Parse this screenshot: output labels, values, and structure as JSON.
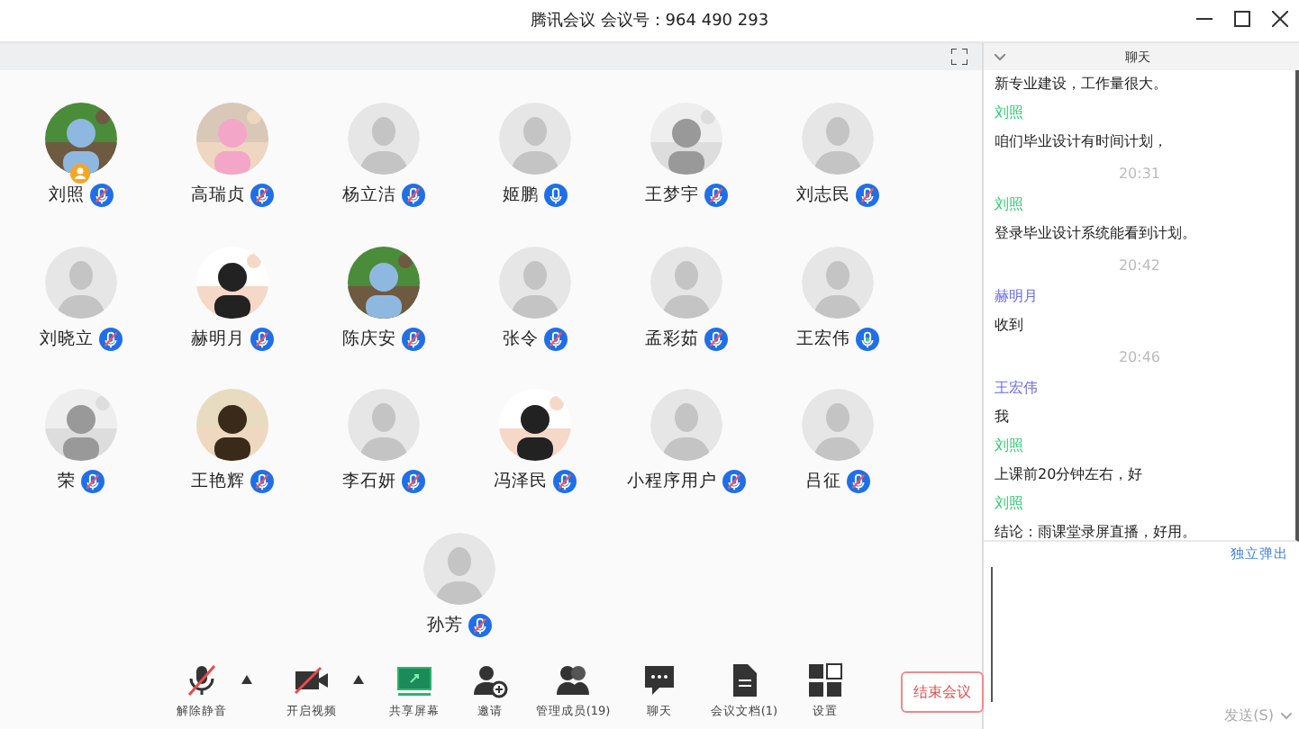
{
  "window": {
    "title": "腾讯会议 会议号：964 490 293"
  },
  "participants": [
    {
      "name": "刘照",
      "photo": true,
      "muted": true,
      "speaking": false,
      "host": true
    },
    {
      "name": "高瑞贞",
      "photo": true,
      "muted": true,
      "speaking": false,
      "host": false
    },
    {
      "name": "杨立洁",
      "photo": false,
      "muted": true,
      "speaking": false,
      "host": false
    },
    {
      "name": "姬鹏",
      "photo": false,
      "muted": false,
      "speaking": false,
      "host": false
    },
    {
      "name": "王梦宇",
      "photo": true,
      "muted": true,
      "speaking": false,
      "host": false
    },
    {
      "name": "刘志民",
      "photo": false,
      "muted": true,
      "speaking": false,
      "host": false
    },
    {
      "name": "刘晓立",
      "photo": false,
      "muted": true,
      "speaking": false,
      "host": false
    },
    {
      "name": "赫明月",
      "photo": true,
      "muted": true,
      "speaking": false,
      "host": false
    },
    {
      "name": "陈庆安",
      "photo": true,
      "muted": true,
      "speaking": false,
      "host": false
    },
    {
      "name": "张令",
      "photo": false,
      "muted": true,
      "speaking": false,
      "host": false
    },
    {
      "name": "孟彩茹",
      "photo": false,
      "muted": true,
      "speaking": false,
      "host": false
    },
    {
      "name": "王宏伟",
      "photo": false,
      "muted": false,
      "speaking": true,
      "host": false
    },
    {
      "name": "荣",
      "photo": true,
      "muted": true,
      "speaking": false,
      "host": false
    },
    {
      "name": "王艳辉",
      "photo": true,
      "muted": true,
      "speaking": false,
      "host": false
    },
    {
      "name": "李石妍",
      "photo": false,
      "muted": true,
      "speaking": false,
      "host": false
    },
    {
      "name": "冯泽民",
      "photo": true,
      "muted": true,
      "speaking": false,
      "host": false
    },
    {
      "name": "小程序用户",
      "photo": false,
      "muted": true,
      "speaking": false,
      "host": false
    },
    {
      "name": "吕征",
      "photo": false,
      "muted": true,
      "speaking": false,
      "host": false
    },
    {
      "name": "孙芳",
      "photo": false,
      "muted": true,
      "speaking": false,
      "host": false
    }
  ],
  "toolbar": [
    {
      "label": "解除静音",
      "kind": "mic",
      "menu": true
    },
    {
      "label": "开启视频",
      "kind": "video",
      "menu": true
    },
    {
      "label": "共享屏幕",
      "kind": "share",
      "menu": false
    },
    {
      "label": "邀请",
      "kind": "invite",
      "menu": false
    },
    {
      "label": "管理成员(19)",
      "kind": "members",
      "menu": false
    },
    {
      "label": "聊天",
      "kind": "chat",
      "menu": false
    },
    {
      "label": "会议文档(1)",
      "kind": "docs",
      "menu": false
    },
    {
      "label": "设置",
      "kind": "settings",
      "menu": false
    }
  ],
  "end_button": "结束会议",
  "chat": {
    "title": "聊天",
    "messages": [
      {
        "kind": "text",
        "text": "新专业建设，工作量很大。"
      },
      {
        "kind": "sender",
        "text": "刘照",
        "color": "#2ecc71"
      },
      {
        "kind": "text",
        "text": "咱们毕业设计有时间计划，"
      },
      {
        "kind": "time",
        "text": "20:31"
      },
      {
        "kind": "sender",
        "text": "刘照",
        "color": "#2ecc71"
      },
      {
        "kind": "text",
        "text": "登录毕业设计系统能看到计划。"
      },
      {
        "kind": "time",
        "text": "20:42"
      },
      {
        "kind": "sender",
        "text": "赫明月",
        "color": "#6b6bf0"
      },
      {
        "kind": "text",
        "text": "收到"
      },
      {
        "kind": "time",
        "text": "20:46"
      },
      {
        "kind": "sender",
        "text": "王宏伟",
        "color": "#6b6bf0"
      },
      {
        "kind": "text",
        "text": "我"
      },
      {
        "kind": "sender",
        "text": "刘照",
        "color": "#2ecc71"
      },
      {
        "kind": "text",
        "text": "上课前20分钟左右，好"
      },
      {
        "kind": "sender",
        "text": "刘照",
        "color": "#2ecc71"
      },
      {
        "kind": "text",
        "text": "结论：雨课堂录屏直播，好用。"
      }
    ],
    "popout": "独立弹出",
    "send": "发送(S)"
  }
}
